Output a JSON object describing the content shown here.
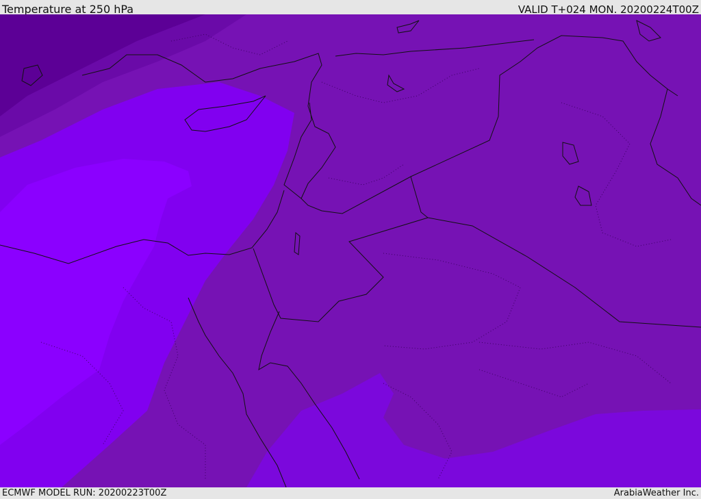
{
  "header": {
    "title": "Temperature at 250 hPa",
    "valid": "VALID T+024 MON. 20200224T00Z"
  },
  "footer": {
    "model_run": "ECMWF MODEL RUN: 20200223T00Z",
    "credit": "ArabiaWeather Inc."
  },
  "map": {
    "variable": "Temperature",
    "level": "250 hPa",
    "region": "Eastern Mediterranean / Middle East",
    "colors": {
      "band_darkest": "#5c0096",
      "band_dark": "#6a0aa8",
      "band_mid": "#7612b4",
      "band_bright": "#8100f0",
      "band_brightest": "#8b00ff",
      "band_south": "#7b08dc"
    }
  }
}
